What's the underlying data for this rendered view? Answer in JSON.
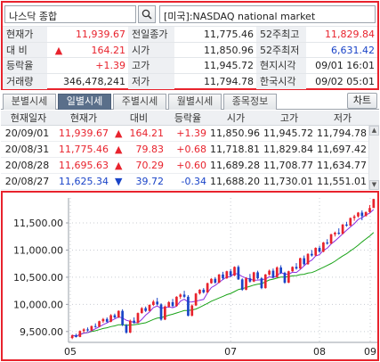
{
  "search": {
    "value": "나스닥 종합"
  },
  "market_label": "[미국]:NASDAQ national market",
  "info": {
    "rows": [
      [
        {
          "label": "현재가",
          "value": "11,939.67",
          "color": "red"
        },
        {
          "label": "전일종가",
          "value": "11,775.46",
          "color": "black"
        },
        {
          "label": "52주최고",
          "value": "11,829.84",
          "color": "red"
        }
      ],
      [
        {
          "label": "대  비",
          "value": "164.21",
          "color": "red",
          "arrow": "▲"
        },
        {
          "label": "시가",
          "value": "11,850.96",
          "color": "black"
        },
        {
          "label": "52주최저",
          "value": "6,631.42",
          "color": "blue"
        }
      ],
      [
        {
          "label": "등락율",
          "value": "+1.39",
          "color": "red"
        },
        {
          "label": "고가",
          "value": "11,945.72",
          "color": "black"
        },
        {
          "label": "현지시각",
          "value": "09/01 16:01",
          "color": "black"
        }
      ],
      [
        {
          "label": "거래량",
          "value": "346,478,241",
          "color": "black"
        },
        {
          "label": "저가",
          "value": "11,794.78",
          "color": "black"
        },
        {
          "label": "한국시각",
          "value": "09/02 05:01",
          "color": "black"
        }
      ]
    ]
  },
  "tabs": [
    {
      "label": "분별시세",
      "active": false
    },
    {
      "label": "일별시세",
      "active": true
    },
    {
      "label": "주별시세",
      "active": false
    },
    {
      "label": "월별시세",
      "active": false
    },
    {
      "label": "종목정보",
      "active": false
    }
  ],
  "chart_button": "차트",
  "daily_table": {
    "headers": [
      "현재일자",
      "현재가",
      "대비",
      "등락율",
      "시가",
      "고가",
      "저가"
    ],
    "rows": [
      {
        "date": "20/09/01",
        "close": "11,939.67",
        "arrow": "▲",
        "change": "164.21",
        "rate": "+1.39",
        "open": "11,850.96",
        "high": "11,945.72",
        "low": "11,794.78",
        "color": "red"
      },
      {
        "date": "20/08/31",
        "close": "11,775.46",
        "arrow": "▲",
        "change": "79.83",
        "rate": "+0.68",
        "open": "11,718.81",
        "high": "11,829.84",
        "low": "11,697.42",
        "color": "red"
      },
      {
        "date": "20/08/28",
        "close": "11,695.63",
        "arrow": "▲",
        "change": "70.29",
        "rate": "+0.60",
        "open": "11,689.28",
        "high": "11,708.77",
        "low": "11,634.77",
        "color": "red"
      },
      {
        "date": "20/08/27",
        "close": "11,625.34",
        "arrow": "▼",
        "change": "39.72",
        "rate": "-0.34",
        "open": "11,688.20",
        "high": "11,730.01",
        "low": "11,551.01",
        "color": "blue"
      }
    ]
  },
  "colors": {
    "up": "#e8232d",
    "down": "#1a44c8",
    "ma_short": "#8a2be2",
    "ma_long": "#1aa318",
    "frame": "#e8232d"
  },
  "icons": {
    "search": "magnifier-icon",
    "scroll_up": "chevron-up-icon",
    "scroll_down": "chevron-down-icon"
  },
  "chart_data": {
    "type": "candlestick",
    "title": "",
    "y_ticks": [
      "11,500.00",
      "11,000.00",
      "10,500.00",
      "10,000.00",
      "9,500.00"
    ],
    "x_ticks": [
      "05",
      "07",
      "08",
      "09"
    ],
    "ylim": [
      9300,
      11960
    ],
    "grid": "dotted",
    "series": [
      {
        "name": "",
        "kind": "ohlc",
        "values": [
          [
            9380,
            9445,
            9360,
            9430
          ],
          [
            9430,
            9460,
            9390,
            9400
          ],
          [
            9400,
            9520,
            9395,
            9510
          ],
          [
            9510,
            9560,
            9480,
            9540
          ],
          [
            9540,
            9575,
            9500,
            9520
          ],
          [
            9520,
            9610,
            9510,
            9600
          ],
          [
            9600,
            9650,
            9570,
            9590
          ],
          [
            9590,
            9700,
            9580,
            9690
          ],
          [
            9690,
            9750,
            9660,
            9730
          ],
          [
            9730,
            9760,
            9660,
            9680
          ],
          [
            9680,
            9820,
            9670,
            9800
          ],
          [
            9800,
            9830,
            9740,
            9760
          ],
          [
            9760,
            9890,
            9750,
            9880
          ],
          [
            9880,
            9910,
            9600,
            9620
          ],
          [
            9620,
            9640,
            9460,
            9480
          ],
          [
            9480,
            9720,
            9470,
            9700
          ],
          [
            9700,
            9760,
            9640,
            9660
          ],
          [
            9660,
            9850,
            9650,
            9840
          ],
          [
            9840,
            9950,
            9830,
            9930
          ],
          [
            9930,
            9960,
            9860,
            9880
          ],
          [
            9880,
            10000,
            9870,
            9990
          ],
          [
            9990,
            10080,
            9970,
            10050
          ],
          [
            10050,
            10120,
            9980,
            10000
          ],
          [
            10000,
            10020,
            9700,
            9720
          ],
          [
            9720,
            9980,
            9710,
            9960
          ],
          [
            9960,
            10060,
            9940,
            10040
          ],
          [
            10040,
            10100,
            9950,
            9970
          ],
          [
            9970,
            10150,
            9960,
            10140
          ],
          [
            10140,
            10200,
            10100,
            10180
          ],
          [
            10180,
            10250,
            10120,
            10140
          ],
          [
            10140,
            10170,
            9780,
            9790
          ],
          [
            9790,
            10000,
            9780,
            9980
          ],
          [
            9980,
            10210,
            9970,
            10200
          ],
          [
            10200,
            10280,
            10180,
            10270
          ],
          [
            10270,
            10300,
            10200,
            10220
          ],
          [
            10220,
            10400,
            10210,
            10390
          ],
          [
            10390,
            10480,
            10380,
            10470
          ],
          [
            10470,
            10500,
            10380,
            10400
          ],
          [
            10400,
            10560,
            10390,
            10550
          ],
          [
            10550,
            10600,
            10450,
            10480
          ],
          [
            10480,
            10620,
            10470,
            10610
          ],
          [
            10610,
            10650,
            10500,
            10530
          ],
          [
            10530,
            10700,
            10520,
            10690
          ],
          [
            10690,
            10720,
            10450,
            10460
          ],
          [
            10460,
            10480,
            10250,
            10270
          ],
          [
            10270,
            10500,
            10260,
            10480
          ],
          [
            10480,
            10560,
            10400,
            10420
          ],
          [
            10420,
            10600,
            10410,
            10590
          ],
          [
            10590,
            10620,
            10460,
            10480
          ],
          [
            10480,
            10500,
            10280,
            10300
          ],
          [
            10300,
            10560,
            10290,
            10550
          ],
          [
            10550,
            10640,
            10530,
            10620
          ],
          [
            10620,
            10660,
            10480,
            10500
          ],
          [
            10500,
            10700,
            10490,
            10680
          ],
          [
            10680,
            10720,
            10560,
            10580
          ],
          [
            10580,
            10600,
            10380,
            10400
          ],
          [
            10400,
            10620,
            10390,
            10610
          ],
          [
            10610,
            10700,
            10600,
            10690
          ],
          [
            10690,
            10760,
            10640,
            10660
          ],
          [
            10660,
            10860,
            10650,
            10850
          ],
          [
            10850,
            10900,
            10720,
            10740
          ],
          [
            10740,
            10940,
            10730,
            10930
          ],
          [
            10930,
            11000,
            10880,
            10900
          ],
          [
            10900,
            11050,
            10890,
            11040
          ],
          [
            11040,
            11080,
            10950,
            10970
          ],
          [
            10970,
            11150,
            10960,
            11140
          ],
          [
            11140,
            11200,
            11100,
            11120
          ],
          [
            11120,
            11300,
            11110,
            11290
          ],
          [
            11290,
            11340,
            11250,
            11320
          ],
          [
            11320,
            11400,
            11280,
            11300
          ],
          [
            11300,
            11480,
            11290,
            11470
          ],
          [
            11470,
            11520,
            11430,
            11450
          ],
          [
            11450,
            11600,
            11440,
            11590
          ],
          [
            11590,
            11650,
            11540,
            11620
          ],
          [
            11620,
            11700,
            11600,
            11690
          ],
          [
            11690,
            11730,
            11550,
            11625
          ],
          [
            11625,
            11710,
            11620,
            11700
          ],
          [
            11700,
            11830,
            11690,
            11775
          ],
          [
            11775,
            11945,
            11790,
            11940
          ]
        ]
      },
      {
        "name": "",
        "kind": "ma_short"
      },
      {
        "name": "",
        "kind": "ma_long"
      }
    ]
  }
}
